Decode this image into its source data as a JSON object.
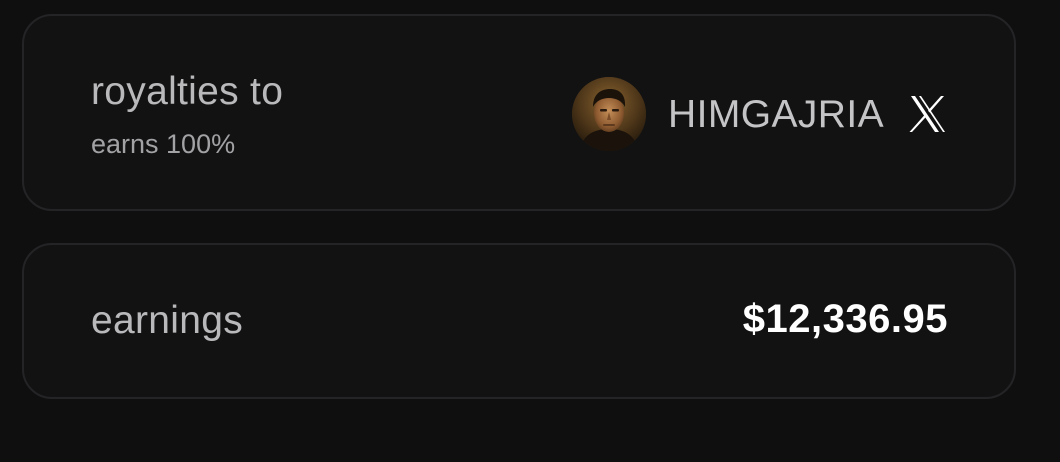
{
  "royalties": {
    "title": "royalties to",
    "subtitle": "earns 100%",
    "recipient": {
      "handle": "HIMGAJRIA",
      "avatar_icon": "portrait-avatar",
      "social_icon": "x-logo-icon"
    }
  },
  "earnings": {
    "label": "earnings",
    "value": "$12,336.95"
  },
  "colors": {
    "background": "#0f0f10",
    "card": "#121213",
    "card_border": "#242426",
    "muted_text": "#b9b9bb",
    "value_text": "#ffffff"
  }
}
